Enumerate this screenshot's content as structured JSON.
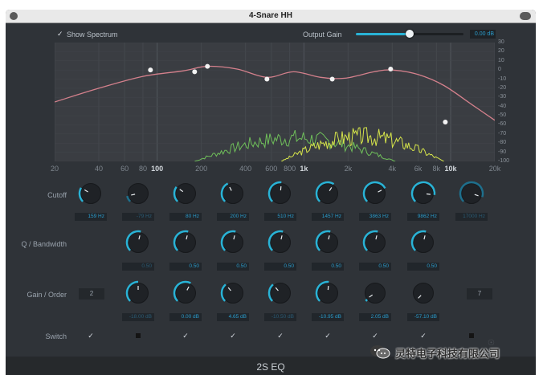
{
  "window": {
    "title": "4-Snare HH"
  },
  "spectrum": {
    "label": "Show Spectrum",
    "checked": true
  },
  "output_gain": {
    "label": "Output Gain",
    "value": "0.00 dB",
    "level": 0.5
  },
  "freq_ticks": [
    {
      "label": "20",
      "f": 20,
      "bold": false
    },
    {
      "label": "40",
      "f": 40,
      "bold": false
    },
    {
      "label": "60",
      "f": 60,
      "bold": false
    },
    {
      "label": "80",
      "f": 80,
      "bold": false
    },
    {
      "label": "100",
      "f": 100,
      "bold": true
    },
    {
      "label": "200",
      "f": 200,
      "bold": false
    },
    {
      "label": "400",
      "f": 400,
      "bold": false
    },
    {
      "label": "600",
      "f": 600,
      "bold": false
    },
    {
      "label": "800",
      "f": 800,
      "bold": false
    },
    {
      "label": "1k",
      "f": 1000,
      "bold": true
    },
    {
      "label": "2k",
      "f": 2000,
      "bold": false
    },
    {
      "label": "4k",
      "f": 4000,
      "bold": false
    },
    {
      "label": "6k",
      "f": 6000,
      "bold": false
    },
    {
      "label": "8k",
      "f": 8000,
      "bold": false
    },
    {
      "label": "10k",
      "f": 10000,
      "bold": true
    },
    {
      "label": "20k",
      "f": 20000,
      "bold": false
    }
  ],
  "db_ticks": [
    "30",
    "20",
    "10",
    "0",
    "-10",
    "-20",
    "-30",
    "-40",
    "-50",
    "-60",
    "-70",
    "-80",
    "-90",
    "-100"
  ],
  "db_range": [
    -100,
    30
  ],
  "eq_nodes": [
    {
      "f": 90,
      "db": 0
    },
    {
      "f": 180,
      "db": -2
    },
    {
      "f": 220,
      "db": 4
    },
    {
      "f": 560,
      "db": -10
    },
    {
      "f": 1560,
      "db": -10
    },
    {
      "f": 3900,
      "db": 1
    },
    {
      "f": 9200,
      "db": -57
    }
  ],
  "eq_curve": [
    {
      "f": 20,
      "db": -35
    },
    {
      "f": 40,
      "db": -20
    },
    {
      "f": 80,
      "db": -7
    },
    {
      "f": 150,
      "db": -1
    },
    {
      "f": 220,
      "db": 4
    },
    {
      "f": 350,
      "db": 1
    },
    {
      "f": 560,
      "db": -8
    },
    {
      "f": 850,
      "db": -2
    },
    {
      "f": 1300,
      "db": -8
    },
    {
      "f": 1900,
      "db": -9
    },
    {
      "f": 3000,
      "db": -2
    },
    {
      "f": 4000,
      "db": 0
    },
    {
      "f": 6000,
      "db": -5
    },
    {
      "f": 9000,
      "db": -17
    },
    {
      "f": 14000,
      "db": -38
    },
    {
      "f": 20000,
      "db": -55
    }
  ],
  "rows": {
    "cutoff": "Cutoff",
    "q": "Q / Bandwidth",
    "gain": "Gain / Order",
    "switch": "Switch"
  },
  "bands": [
    {
      "cutoff": "159 Hz",
      "cutoff_dim": false,
      "q": "",
      "gain": "",
      "order": "2",
      "switch": true
    },
    {
      "cutoff": "-79 Hz",
      "cutoff_dim": true,
      "q": "0.50",
      "gain": "-18.00 dB",
      "order": "",
      "switch": false
    },
    {
      "cutoff": "80 Hz",
      "cutoff_dim": false,
      "q": "0.50",
      "gain": "0.00 dB",
      "order": "",
      "switch": true
    },
    {
      "cutoff": "200 Hz",
      "cutoff_dim": false,
      "q": "0.50",
      "gain": "4.65 dB",
      "order": "",
      "switch": true
    },
    {
      "cutoff": "510 Hz",
      "cutoff_dim": false,
      "q": "0.50",
      "gain": "-10.50 dB",
      "order": "",
      "switch": true
    },
    {
      "cutoff": "1457 Hz",
      "cutoff_dim": false,
      "q": "0.50",
      "gain": "-10.95 dB",
      "order": "",
      "switch": true
    },
    {
      "cutoff": "3863 Hz",
      "cutoff_dim": false,
      "q": "0.50",
      "gain": "2.05 dB",
      "order": "",
      "switch": true
    },
    {
      "cutoff": "9862 Hz",
      "cutoff_dim": false,
      "q": "0.50",
      "gain": "-57.10 dB",
      "order": "",
      "switch": true
    },
    {
      "cutoff": "17000 Hz",
      "cutoff_dim": true,
      "q": "",
      "gain": "",
      "order": "7",
      "switch": false
    }
  ],
  "knobs": {
    "cutoff": [
      0.28,
      0.12,
      0.3,
      0.4,
      0.52,
      0.62,
      0.73,
      0.86,
      0.9
    ],
    "q": [
      0.2,
      0.55,
      0.55,
      0.55,
      0.55,
      0.55,
      0.55,
      0.55,
      0
    ],
    "gain": [
      0.05,
      0.5,
      0.6,
      0.35,
      0.35,
      0.52,
      0.04,
      0,
      0
    ]
  },
  "footer": {
    "name": "2S EQ"
  },
  "watermark": {
    "text": "灵特电子科技有限公司"
  },
  "colors": {
    "accent": "#29b3d6",
    "curve": "#d4808c",
    "spectrum_yellow": "#d6e54a",
    "spectrum_green": "#6fbf5a"
  }
}
